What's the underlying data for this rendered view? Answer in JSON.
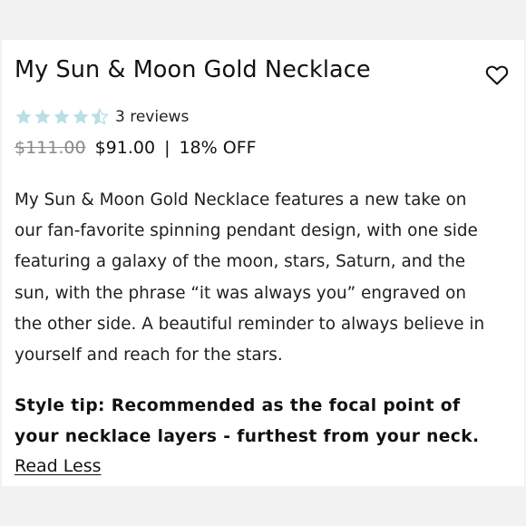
{
  "product": {
    "title": "My Sun & Moon Gold Necklace",
    "wishlist_icon": "heart-outline-icon",
    "rating": {
      "value": 4.5,
      "max": 5,
      "star_color": "#b9dfe5",
      "reviews_label": "3 reviews"
    },
    "price": {
      "original": "$111.00",
      "current": "$91.00",
      "separator": "|",
      "discount": "18% OFF"
    },
    "description_lines": [
      "My Sun & Moon Gold Necklace features a new take on",
      "our fan-favorite spinning pendant design, with one side",
      "featuring a galaxy of the moon, stars, Saturn, and the",
      "sun, with the phrase “it was always you” engraved on",
      "the other side. A beautiful reminder to always believe in",
      "yourself and reach for the stars."
    ],
    "style_tip_lines": [
      "Style tip: Recommended as the focal point of",
      "your necklace layers - furthest from your neck."
    ],
    "read_less_label": "Read Less"
  }
}
